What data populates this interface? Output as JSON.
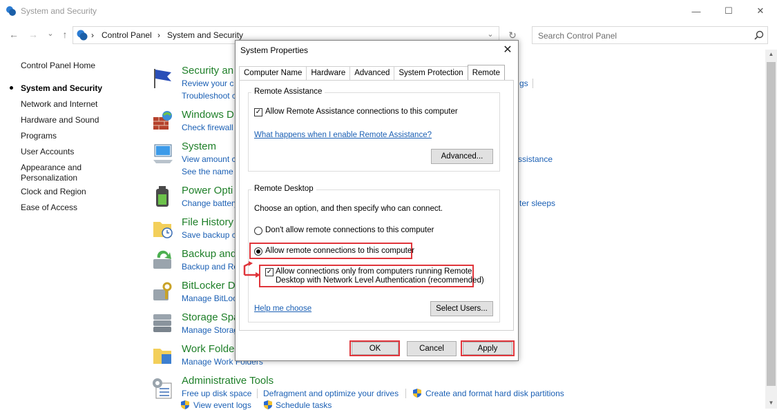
{
  "window": {
    "title": "System and Security",
    "minimize": "—",
    "maximize": "☐",
    "close": "✕"
  },
  "nav": {
    "back": "←",
    "forward": "→",
    "recent": "⌄",
    "up": "↑",
    "dropdown": "⌄",
    "refresh": "↻"
  },
  "breadcrumb": {
    "sep1": "›",
    "item1": "Control Panel",
    "sep2": "›",
    "item2": "System and Security"
  },
  "search": {
    "placeholder": "Search Control Panel"
  },
  "sidebar": {
    "items": [
      {
        "label": "Control Panel Home"
      },
      {
        "label": "System and Security"
      },
      {
        "label": "Network and Internet"
      },
      {
        "label": "Hardware and Sound"
      },
      {
        "label": "Programs"
      },
      {
        "label": "User Accounts"
      },
      {
        "label": "Appearance and"
      },
      {
        "label": "Personalization"
      },
      {
        "label": "Clock and Region"
      },
      {
        "label": "Ease of Access"
      }
    ]
  },
  "categories": [
    {
      "title": "Security an",
      "links": [
        "Review your c",
        "Troubleshoot c"
      ],
      "icon": "flag-icon"
    },
    {
      "title": "Windows D",
      "links": [
        "Check firewall"
      ],
      "icon": "firewall-icon"
    },
    {
      "title": "System",
      "links": [
        "View amount c",
        "See the name c"
      ],
      "icon": "computer-icon"
    },
    {
      "title": "Power Opti",
      "links": [
        "Change battery"
      ],
      "icon": "battery-icon"
    },
    {
      "title": "File History",
      "links": [
        "Save backup co"
      ],
      "icon": "folder-clock-icon"
    },
    {
      "title": "Backup and",
      "links": [
        "Backup and Re"
      ],
      "icon": "backup-icon"
    },
    {
      "title": "BitLocker D",
      "links": [
        "Manage BitLoc"
      ],
      "icon": "bitlocker-icon"
    },
    {
      "title": "Storage Spa",
      "links": [
        "Manage Storag"
      ],
      "icon": "storage-icon"
    },
    {
      "title": "Work Folde",
      "links": [
        "Manage Work Folders"
      ],
      "icon": "work-folders-icon"
    },
    {
      "title": "Administrative Tools",
      "links": [
        "Free up disk space",
        "Defragment and optimize your drives",
        "Create and format hard disk partitions",
        "View event logs",
        "Schedule tasks"
      ],
      "icon": "admin-tools-icon"
    }
  ],
  "right_links": {
    "gs": "gs",
    "assistance": "ssistance",
    "sleeps": "ter sleeps"
  },
  "dialog": {
    "title": "System Properties",
    "close": "✕",
    "tabs": [
      "Computer Name",
      "Hardware",
      "Advanced",
      "System Protection",
      "Remote"
    ],
    "remote_assistance": {
      "label": "Remote Assistance",
      "allow_checkbox": "Allow Remote Assistance connections to this computer",
      "what_happens_link": "What happens when I enable Remote Assistance?",
      "advanced_button": "Advanced..."
    },
    "remote_desktop": {
      "label": "Remote Desktop",
      "instruction": "Choose an option, and then specify who can connect.",
      "option_dont_allow": "Don't allow remote connections to this computer",
      "option_allow": "Allow remote connections to this computer",
      "nla_line1": "Allow connections only from computers running Remote",
      "nla_line2": "Desktop with Network Level Authentication (recommended)",
      "help_link": "Help me choose",
      "select_users_button": "Select Users..."
    },
    "buttons": {
      "ok": "OK",
      "cancel": "Cancel",
      "apply": "Apply"
    }
  },
  "colors": {
    "highlight": "#e0353b",
    "link": "#1a5fb4",
    "category_title": "#1e7f28"
  }
}
